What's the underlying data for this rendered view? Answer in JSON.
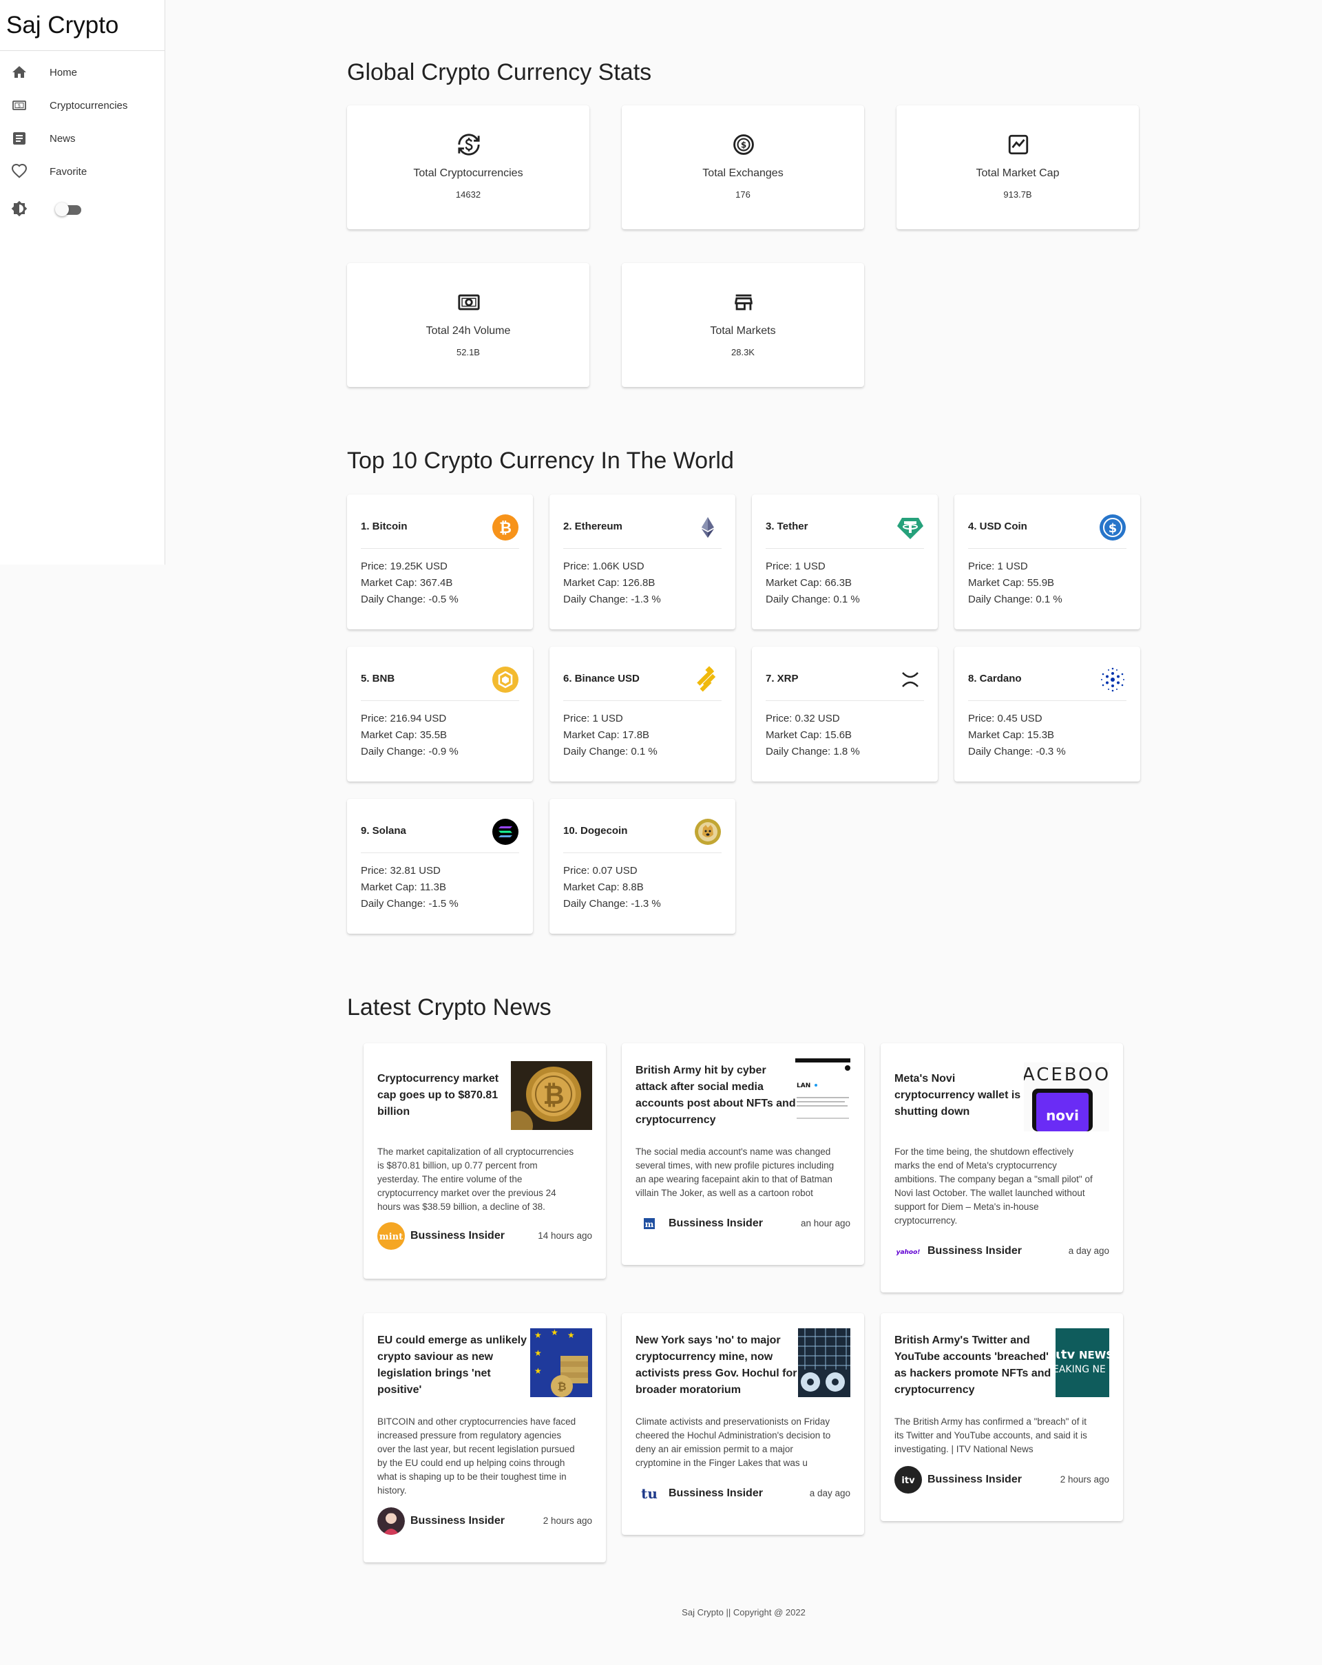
{
  "app": {
    "title": "Saj Crypto"
  },
  "sidebar": {
    "items": [
      {
        "label": "Home",
        "icon": "home-icon"
      },
      {
        "label": "Cryptocurrencies",
        "icon": "currency-icon"
      },
      {
        "label": "News",
        "icon": "news-icon"
      },
      {
        "label": "Favorite",
        "icon": "heart-icon"
      }
    ],
    "theme_toggle": {
      "icon": "brightness-icon",
      "on": false
    }
  },
  "stats": {
    "heading": "Global Crypto Currency Stats",
    "cards": [
      {
        "title": "Total Cryptocurrencies",
        "value": "14632",
        "icon": "currency-exchange-icon"
      },
      {
        "title": "Total Exchanges",
        "value": "176",
        "icon": "dollar-circle-icon"
      },
      {
        "title": "Total Market Cap",
        "value": "913.7B",
        "icon": "chart-icon"
      },
      {
        "title": "Total 24h Volume",
        "value": "52.1B",
        "icon": "cash-icon"
      },
      {
        "title": "Total Markets",
        "value": "28.3K",
        "icon": "store-icon"
      }
    ]
  },
  "top10": {
    "heading": "Top 10 Crypto Currency In The World",
    "coins": [
      {
        "name": "1. Bitcoin",
        "price": "Price: 19.25K USD",
        "cap": "Market Cap: 367.4B",
        "change": "Daily Change: -0.5 %",
        "icon": "bitcoin-icon",
        "color": "#f7931a"
      },
      {
        "name": "2. Ethereum",
        "price": "Price: 1.06K USD",
        "cap": "Market Cap: 126.8B",
        "change": "Daily Change: -1.3 %",
        "icon": "ethereum-icon",
        "color": "#3c3c6e"
      },
      {
        "name": "3. Tether",
        "price": "Price: 1 USD",
        "cap": "Market Cap: 66.3B",
        "change": "Daily Change: 0.1 %",
        "icon": "tether-icon",
        "color": "#26a17b"
      },
      {
        "name": "4. USD Coin",
        "price": "Price: 1 USD",
        "cap": "Market Cap: 55.9B",
        "change": "Daily Change: 0.1 %",
        "icon": "usdc-icon",
        "color": "#2775ca"
      },
      {
        "name": "5. BNB",
        "price": "Price: 216.94 USD",
        "cap": "Market Cap: 35.5B",
        "change": "Daily Change: -0.9 %",
        "icon": "bnb-icon",
        "color": "#f3ba2f"
      },
      {
        "name": "6. Binance USD",
        "price": "Price: 1 USD",
        "cap": "Market Cap: 17.8B",
        "change": "Daily Change: 0.1 %",
        "icon": "binance-usd-icon",
        "color": "#f0b90b"
      },
      {
        "name": "7. XRP",
        "price": "Price: 0.32 USD",
        "cap": "Market Cap: 15.6B",
        "change": "Daily Change: 1.8 %",
        "icon": "xrp-icon",
        "color": "#222222"
      },
      {
        "name": "8. Cardano",
        "price": "Price: 0.45 USD",
        "cap": "Market Cap: 15.3B",
        "change": "Daily Change: -0.3 %",
        "icon": "cardano-icon",
        "color": "#0033ad"
      },
      {
        "name": "9. Solana",
        "price": "Price: 32.81 USD",
        "cap": "Market Cap: 11.3B",
        "change": "Daily Change: -1.5 %",
        "icon": "solana-icon",
        "color": "#000000"
      },
      {
        "name": "10. Dogecoin",
        "price": "Price: 0.07 USD",
        "cap": "Market Cap: 8.8B",
        "change": "Daily Change: -1.3 %",
        "icon": "dogecoin-icon",
        "color": "#c2a633"
      }
    ]
  },
  "news": {
    "heading": "Latest Crypto News",
    "articles": [
      {
        "title_lines": [
          "Cryptocurrency market",
          "cap goes up to $870.81",
          "billion"
        ],
        "desc_lines": [
          "The market capitalization of all cryptocurrencies",
          "is $870.81 billion, up 0.77 percent from",
          "yesterday. The entire volume of the",
          "cryptocurrency market over the previous 24",
          "hours was $38.59 billion, a decline of 38."
        ],
        "provider": "Bussiness Insider",
        "time": "14 hours ago",
        "avatar": "mint",
        "image": "bitcoin-coin-image"
      },
      {
        "title_lines": [
          "British Army hit by cyber",
          "attack after social media",
          "accounts post about NFTs and",
          "cryptocurrency"
        ],
        "desc_lines": [
          "The social media account's name was changed",
          "several times, with new profile pictures including",
          "an ape wearing facepaint akin to that of Batman",
          "villain The Joker, as well as a cartoon robot"
        ],
        "provider": "Bussiness Insider",
        "time": "an hour ago",
        "avatar": "m",
        "image": "twitter-screenshot-image",
        "image_text": "LAN"
      },
      {
        "title_lines": [
          "Meta's Novi",
          "cryptocurrency wallet is",
          "shutting down"
        ],
        "desc_lines": [
          "For the time being, the shutdown effectively",
          "marks the end of Meta's cryptocurrency",
          "ambitions. The company began a \"small pilot\" of",
          "Novi last October. The wallet launched without",
          "support for Diem – Meta's in-house",
          "cryptocurrency."
        ],
        "provider": "Bussiness Insider",
        "time": "a day ago",
        "avatar": "yahoo!",
        "image": "novi-phone-image",
        "image_text": "ACEBOO",
        "image_text2": "novi"
      },
      {
        "title_lines": [
          "EU could emerge as unlikely",
          "crypto saviour as new",
          "legislation brings 'net",
          "positive'"
        ],
        "desc_lines": [
          "BITCOIN and other cryptocurrencies have faced",
          "increased pressure from regulatory agencies",
          "over the last year, but recent legislation pursued",
          "by the EU could end up helping coins through",
          "what is shaping up to be their toughest time in",
          "history."
        ],
        "provider": "Bussiness Insider",
        "time": "2 hours ago",
        "avatar": "person",
        "image": "eu-flag-coins-image"
      },
      {
        "title_lines": [
          "New York says 'no' to major",
          "cryptocurrency mine, now",
          "activists press Gov. Hochul for",
          "broader moratorium"
        ],
        "desc_lines": [
          "Climate activists and preservationists on Friday",
          "cheered the Hochul Administration's decision to",
          "deny an air emission permit to a major",
          "cryptomine in the Finger Lakes that was u"
        ],
        "provider": "Bussiness Insider",
        "time": "a day ago",
        "avatar": "tu",
        "image": "crypto-mine-image"
      },
      {
        "title_lines": [
          "British Army's Twitter and",
          "YouTube accounts 'breached'",
          "as hackers promote NFTs and",
          "cryptocurrency"
        ],
        "desc_lines": [
          "The British Army has confirmed a \"breach\" of it",
          "its Twitter and YouTube accounts, and said it is",
          "investigating. | ITV National News"
        ],
        "provider": "Bussiness Insider",
        "time": "2 hours ago",
        "avatar": "itv",
        "image": "itv-news-image",
        "image_text": "NEWS",
        "image_text2": "EAKING NE"
      }
    ]
  },
  "footer": {
    "text": "Saj Crypto || Copyright @ 2022"
  }
}
